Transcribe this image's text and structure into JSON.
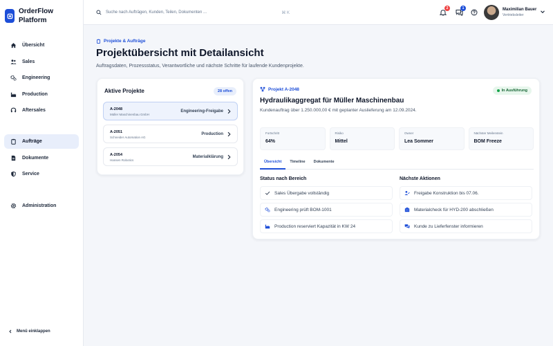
{
  "brand": {
    "name": "OrderFlow Platform"
  },
  "sidebar": {
    "items": [
      {
        "label": "Übersicht",
        "icon": "home-icon"
      },
      {
        "label": "Sales",
        "icon": "users-icon"
      },
      {
        "label": "Engineering",
        "icon": "gears-icon"
      },
      {
        "label": "Production",
        "icon": "factory-icon"
      },
      {
        "label": "Aftersales",
        "icon": "headset-icon"
      },
      {
        "label": "Aufträge",
        "icon": "clipboard-icon",
        "active": true
      },
      {
        "label": "Dokumente",
        "icon": "document-icon"
      },
      {
        "label": "Service",
        "icon": "shield-icon"
      },
      {
        "label": "Administration",
        "icon": "gear-icon"
      }
    ],
    "collapse_label": "Menü einklappen"
  },
  "header": {
    "search_placeholder": "Suche nach Aufträgen, Kunden, Teilen, Dokumenten ...",
    "search_shortcut": "⌘ K",
    "notifications_count": "2",
    "messages_count": "1",
    "user_name": "Maximilian Bauer",
    "user_role": "Vertriebsleiter"
  },
  "page": {
    "breadcrumb": "Projekte & Aufträge",
    "title": "Projektübersicht mit Detailansicht",
    "subtitle": "Auftragsdaten, Prozessstatus, Verantwortliche und nächste Schritte für laufende Kundenprojekte."
  },
  "projects": {
    "title": "Aktive Projekte",
    "count_label": "28 offen",
    "items": [
      {
        "id": "A-2048",
        "customer": "Müller Maschinenbau GmbH",
        "stage": "Engineering-Freigabe"
      },
      {
        "id": "A-2051",
        "customer": "Schneider Automation AG",
        "stage": "Production"
      },
      {
        "id": "A-2054",
        "customer": "Hansen Robotics",
        "stage": "Materialklärung"
      }
    ]
  },
  "detail": {
    "project_label": "Projekt A-2048",
    "status": "In Ausführung",
    "title": "Hydraulikaggregat für Müller Maschinenbau",
    "subtitle": "Kundenauftrag über 1.250.000,00 € mit geplanter Auslieferung am 12.09.2024.",
    "kpis": [
      {
        "label": "Fortschritt",
        "value": "64%"
      },
      {
        "label": "Risiko",
        "value": "Mittel"
      },
      {
        "label": "Owner",
        "value": "Lea Sommer"
      },
      {
        "label": "Nächster Meilenstein",
        "value": "BOM Freeze"
      }
    ],
    "tabs": [
      "Übersicht",
      "Timeline",
      "Dokumente"
    ],
    "status_title": "Status nach Bereich",
    "status_rows": [
      {
        "text": "Sales Übergabe vollständig",
        "icon": "check-icon"
      },
      {
        "text": "Engineering prüft BOM-1001",
        "icon": "gears-icon"
      },
      {
        "text": "Production reserviert Kapazität in KW 24",
        "icon": "factory-icon"
      }
    ],
    "actions_title": "Nächste Aktionen",
    "action_rows": [
      {
        "text": "Freigabe Konstruktion bis 07.06.",
        "icon": "user-check-icon"
      },
      {
        "text": "Materialcheck für HYD-200 abschließen",
        "icon": "building-icon"
      },
      {
        "text": "Kunde zu Lieferfenster informieren",
        "icon": "chat-icon"
      }
    ]
  },
  "colors": {
    "accent": "#1d4ed8",
    "success": "#16a34a",
    "danger": "#ef4444"
  }
}
